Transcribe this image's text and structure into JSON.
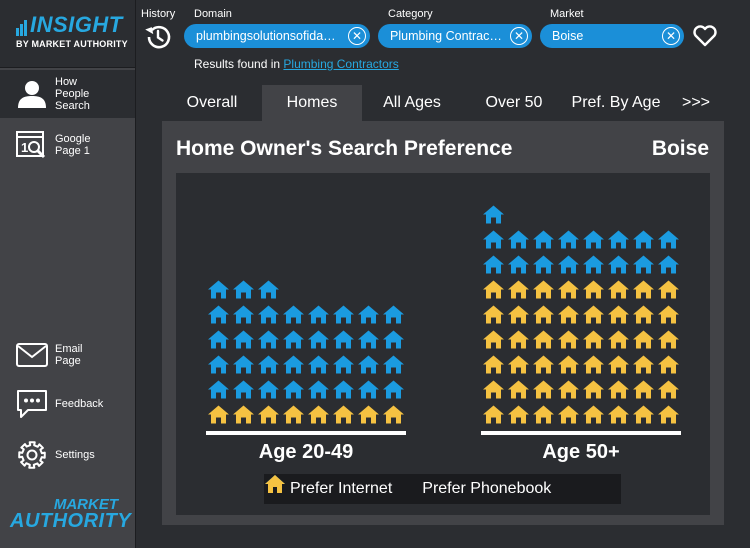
{
  "brand": {
    "name": "INSIGHT",
    "subtitle": "BY MARKET AUTHORITY",
    "footer_line1": "MARKET",
    "footer_line2": "AUTHORITY",
    "accent": "#27a8e0"
  },
  "sidebar": {
    "items": [
      {
        "label": "How\nPeople\nSearch",
        "icon": "person-icon",
        "active": true
      },
      {
        "label": "Google\nPage 1",
        "icon": "search-page-icon",
        "active": false
      },
      {
        "label": "Email\nPage",
        "icon": "envelope-icon",
        "active": false
      },
      {
        "label": "Feedback",
        "icon": "chat-bubble-icon",
        "active": false
      },
      {
        "label": "Settings",
        "icon": "gear-icon",
        "active": false
      }
    ]
  },
  "header": {
    "history_label": "History",
    "domain_label": "Domain",
    "domain_value": "plumbingsolutionsofidaho.com",
    "category_label": "Category",
    "category_value": "Plumbing Contractors",
    "market_label": "Market",
    "market_value": "Boise",
    "pill_color": "#1b8fd8",
    "results_prefix": "Results found in",
    "results_link": "Plumbing Contractors"
  },
  "tabs": [
    {
      "label": "Overall",
      "active": false
    },
    {
      "label": "Homes",
      "active": true
    },
    {
      "label": "All Ages",
      "active": false
    },
    {
      "label": "Over 50",
      "active": false
    },
    {
      "label": "Pref. By Age",
      "active": false
    },
    {
      "label": ">>>",
      "active": false
    }
  ],
  "panel": {
    "title": "Home Owner's Search Preference",
    "market": "Boise"
  },
  "chart_data": {
    "type": "pictograph",
    "icon": "house-icon",
    "groups": [
      {
        "label": "Age 20-49",
        "internet": 35,
        "phonebook": 8
      },
      {
        "label": "Age 50+",
        "internet": 17,
        "phonebook": 48
      }
    ],
    "series": [
      {
        "name": "Prefer Internet",
        "color": "#1b9be0"
      },
      {
        "name": "Prefer Phonebook",
        "color": "#f5c242"
      }
    ],
    "icons_per_row": 8
  }
}
